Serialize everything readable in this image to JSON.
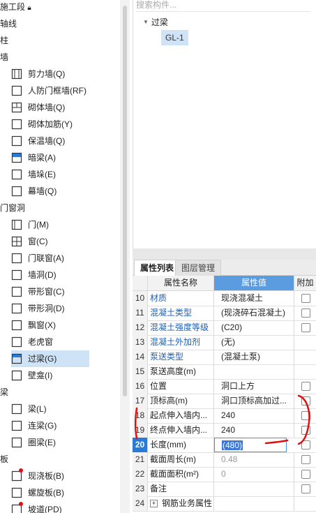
{
  "component_tree": {
    "partial_top_label": "施工段",
    "categories": [
      {
        "label": "轴线",
        "items": []
      },
      {
        "label": "柱",
        "items": []
      },
      {
        "label": "墙",
        "items": [
          {
            "label": "剪力墙(Q)",
            "icon": "shear-wall-icon"
          },
          {
            "label": "人防门框墙(RF)",
            "icon": "civil-defense-door-frame-wall-icon"
          },
          {
            "label": "砌体墙(Q)",
            "icon": "masonry-wall-icon"
          },
          {
            "label": "砌体加筋(Y)",
            "icon": "masonry-reinforcement-icon"
          },
          {
            "label": "保温墙(Q)",
            "icon": "insulation-wall-icon"
          },
          {
            "label": "暗梁(A)",
            "icon": "hidden-beam-icon"
          },
          {
            "label": "墙垛(E)",
            "icon": "wall-pier-icon"
          },
          {
            "label": "幕墙(Q)",
            "icon": "curtain-wall-icon"
          }
        ]
      },
      {
        "label": "门窗洞",
        "items": [
          {
            "label": "门(M)",
            "icon": "door-icon"
          },
          {
            "label": "窗(C)",
            "icon": "window-icon"
          },
          {
            "label": "门联窗(A)",
            "icon": "door-window-icon"
          },
          {
            "label": "墙洞(D)",
            "icon": "wall-opening-icon"
          },
          {
            "label": "带形窗(C)",
            "icon": "strip-window-icon"
          },
          {
            "label": "带形洞(D)",
            "icon": "strip-opening-icon"
          },
          {
            "label": "飘窗(X)",
            "icon": "bay-window-icon"
          },
          {
            "label": "老虎窗",
            "icon": "dormer-window-icon"
          },
          {
            "label": "过梁(G)",
            "icon": "lintel-icon",
            "selected": true
          },
          {
            "label": "壁龛(I)",
            "icon": "niche-icon"
          }
        ]
      },
      {
        "label": "梁",
        "items": [
          {
            "label": "梁(L)",
            "icon": "beam-icon"
          },
          {
            "label": "连梁(G)",
            "icon": "coupling-beam-icon"
          },
          {
            "label": "圈梁(E)",
            "icon": "ring-beam-icon"
          }
        ]
      },
      {
        "label": "板",
        "items": [
          {
            "label": "现浇板(B)",
            "icon": "cast-slab-icon"
          },
          {
            "label": "螺旋板(B)",
            "icon": "spiral-slab-icon"
          },
          {
            "label": "坡道(PD)",
            "icon": "ramp-icon"
          }
        ]
      }
    ]
  },
  "component_list": {
    "search_placeholder": "搜索构件...",
    "group_label": "过梁",
    "selected_item": "GL-1"
  },
  "tabs": {
    "active": "属性列表",
    "other": "图层管理"
  },
  "property_table": {
    "headers": {
      "name": "属性名称",
      "value": "属性值",
      "extra": "附加"
    },
    "rows": [
      {
        "num": "10",
        "name": "材质",
        "value": "现浇混凝土",
        "link": true,
        "check": true
      },
      {
        "num": "11",
        "name": "混凝土类型",
        "value": "(现浇碎石混凝土)",
        "link": true,
        "check": true
      },
      {
        "num": "12",
        "name": "混凝土强度等级",
        "value": "(C20)",
        "link": true,
        "check": true
      },
      {
        "num": "13",
        "name": "混凝土外加剂",
        "value": "(无)",
        "link": true,
        "check": false
      },
      {
        "num": "14",
        "name": "泵送类型",
        "value": "(混凝土泵)",
        "link": true,
        "check": false
      },
      {
        "num": "15",
        "name": "泵送高度(m)",
        "value": "",
        "link": false,
        "check": false
      },
      {
        "num": "16",
        "name": "位置",
        "value": "洞口上方",
        "link": false,
        "check": true
      },
      {
        "num": "17",
        "name": "顶标高(m)",
        "value": "洞口顶标高加过...",
        "link": false,
        "check": true
      },
      {
        "num": "18",
        "name": "起点伸入墙内...",
        "value": "240",
        "link": false,
        "check": true
      },
      {
        "num": "19",
        "name": "终点伸入墙内...",
        "value": "240",
        "link": false,
        "check": true
      },
      {
        "num": "20",
        "name": "长度(mm)",
        "value": "(480)",
        "link": false,
        "check": true,
        "active": true
      },
      {
        "num": "21",
        "name": "截面周长(m)",
        "value": "0.48",
        "link": false,
        "check": true,
        "gray": true
      },
      {
        "num": "22",
        "name": "截面面积(m²)",
        "value": "0",
        "link": false,
        "check": true,
        "gray": true
      },
      {
        "num": "23",
        "name": "备注",
        "value": "",
        "link": false,
        "check": true
      },
      {
        "num": "24",
        "name": "钢筋业务属性",
        "value": "",
        "link": false,
        "check": false,
        "expandable": true,
        "expand_symbol": "+"
      }
    ]
  },
  "colors": {
    "selection": "#cfe3f7",
    "link": "#1f5fb5",
    "active_row": "#2a7ad8",
    "annotation": "#e01010"
  }
}
